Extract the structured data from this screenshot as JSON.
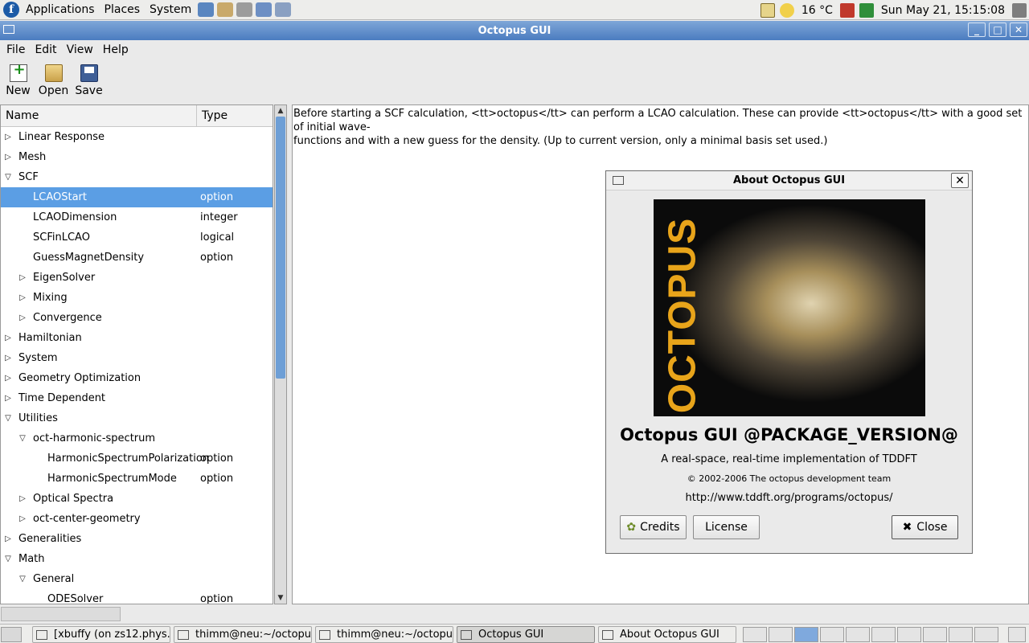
{
  "top_panel": {
    "menus": [
      "Applications",
      "Places",
      "System"
    ],
    "weather": "16 °C",
    "clock": "Sun May 21, 15:15:08"
  },
  "window": {
    "title": "Octopus GUI"
  },
  "menubar": [
    "File",
    "Edit",
    "View",
    "Help"
  ],
  "toolbar": {
    "new_label": "New",
    "open_label": "Open",
    "save_label": "Save"
  },
  "tree": {
    "col_name": "Name",
    "col_type": "Type",
    "rows": [
      {
        "label": "Linear Response",
        "type": "",
        "depth": 0,
        "expander": "collapsed"
      },
      {
        "label": "Mesh",
        "type": "",
        "depth": 0,
        "expander": "collapsed"
      },
      {
        "label": "SCF",
        "type": "",
        "depth": 0,
        "expander": "expanded"
      },
      {
        "label": "LCAOStart",
        "type": "option",
        "depth": 1,
        "expander": "none",
        "selected": true
      },
      {
        "label": "LCAODimension",
        "type": "integer",
        "depth": 1,
        "expander": "none"
      },
      {
        "label": "SCFinLCAO",
        "type": "logical",
        "depth": 1,
        "expander": "none"
      },
      {
        "label": "GuessMagnetDensity",
        "type": "option",
        "depth": 1,
        "expander": "none"
      },
      {
        "label": "EigenSolver",
        "type": "",
        "depth": 1,
        "expander": "collapsed"
      },
      {
        "label": "Mixing",
        "type": "",
        "depth": 1,
        "expander": "collapsed"
      },
      {
        "label": "Convergence",
        "type": "",
        "depth": 1,
        "expander": "collapsed"
      },
      {
        "label": "Hamiltonian",
        "type": "",
        "depth": 0,
        "expander": "collapsed"
      },
      {
        "label": "System",
        "type": "",
        "depth": 0,
        "expander": "collapsed"
      },
      {
        "label": "Geometry Optimization",
        "type": "",
        "depth": 0,
        "expander": "collapsed"
      },
      {
        "label": "Time Dependent",
        "type": "",
        "depth": 0,
        "expander": "collapsed"
      },
      {
        "label": "Utilities",
        "type": "",
        "depth": 0,
        "expander": "expanded"
      },
      {
        "label": "oct-harmonic-spectrum",
        "type": "",
        "depth": 1,
        "expander": "expanded"
      },
      {
        "label": "HarmonicSpectrumPolarization",
        "type": "option",
        "depth": 2,
        "expander": "none"
      },
      {
        "label": "HarmonicSpectrumMode",
        "type": "option",
        "depth": 2,
        "expander": "none"
      },
      {
        "label": "Optical Spectra",
        "type": "",
        "depth": 1,
        "expander": "collapsed"
      },
      {
        "label": "oct-center-geometry",
        "type": "",
        "depth": 1,
        "expander": "collapsed"
      },
      {
        "label": "Generalities",
        "type": "",
        "depth": 0,
        "expander": "collapsed"
      },
      {
        "label": "Math",
        "type": "",
        "depth": 0,
        "expander": "expanded"
      },
      {
        "label": "General",
        "type": "",
        "depth": 1,
        "expander": "expanded"
      },
      {
        "label": "ODESolver",
        "type": "option",
        "depth": 2,
        "expander": "none"
      }
    ]
  },
  "description": {
    "line1": "Before starting a SCF calculation, <tt>octopus</tt> can perform a LCAO calculation. These can provide <tt>octopus</tt> with a good set of initial wave-",
    "line2": "functions and with a new guess for the density. (Up to current version, only a minimal basis set used.)"
  },
  "about_dialog": {
    "title": "About Octopus GUI",
    "logo_text": "OCTOPUS",
    "name": "Octopus GUI @PACKAGE_VERSION@",
    "comment": "A real-space, real-time implementation of TDDFT",
    "copyright": "© 2002-2006 The octopus development team",
    "website": "http://www.tddft.org/programs/octopus/",
    "credits_label": "Credits",
    "license_label": "License",
    "close_label": "Close"
  },
  "taskbar": {
    "tasks": [
      {
        "label": "[xbuffy (on zs12.phys...",
        "active": false
      },
      {
        "label": "thimm@neu:~/octopu...",
        "active": false
      },
      {
        "label": "thimm@neu:~/octopu...",
        "active": false
      },
      {
        "label": "Octopus GUI",
        "active": true
      },
      {
        "label": "About Octopus GUI",
        "active": false
      }
    ]
  },
  "colors": {
    "selection": "#5b9ee4",
    "titlebar": "#4b7cc0",
    "logo_text": "#e8a41a"
  }
}
